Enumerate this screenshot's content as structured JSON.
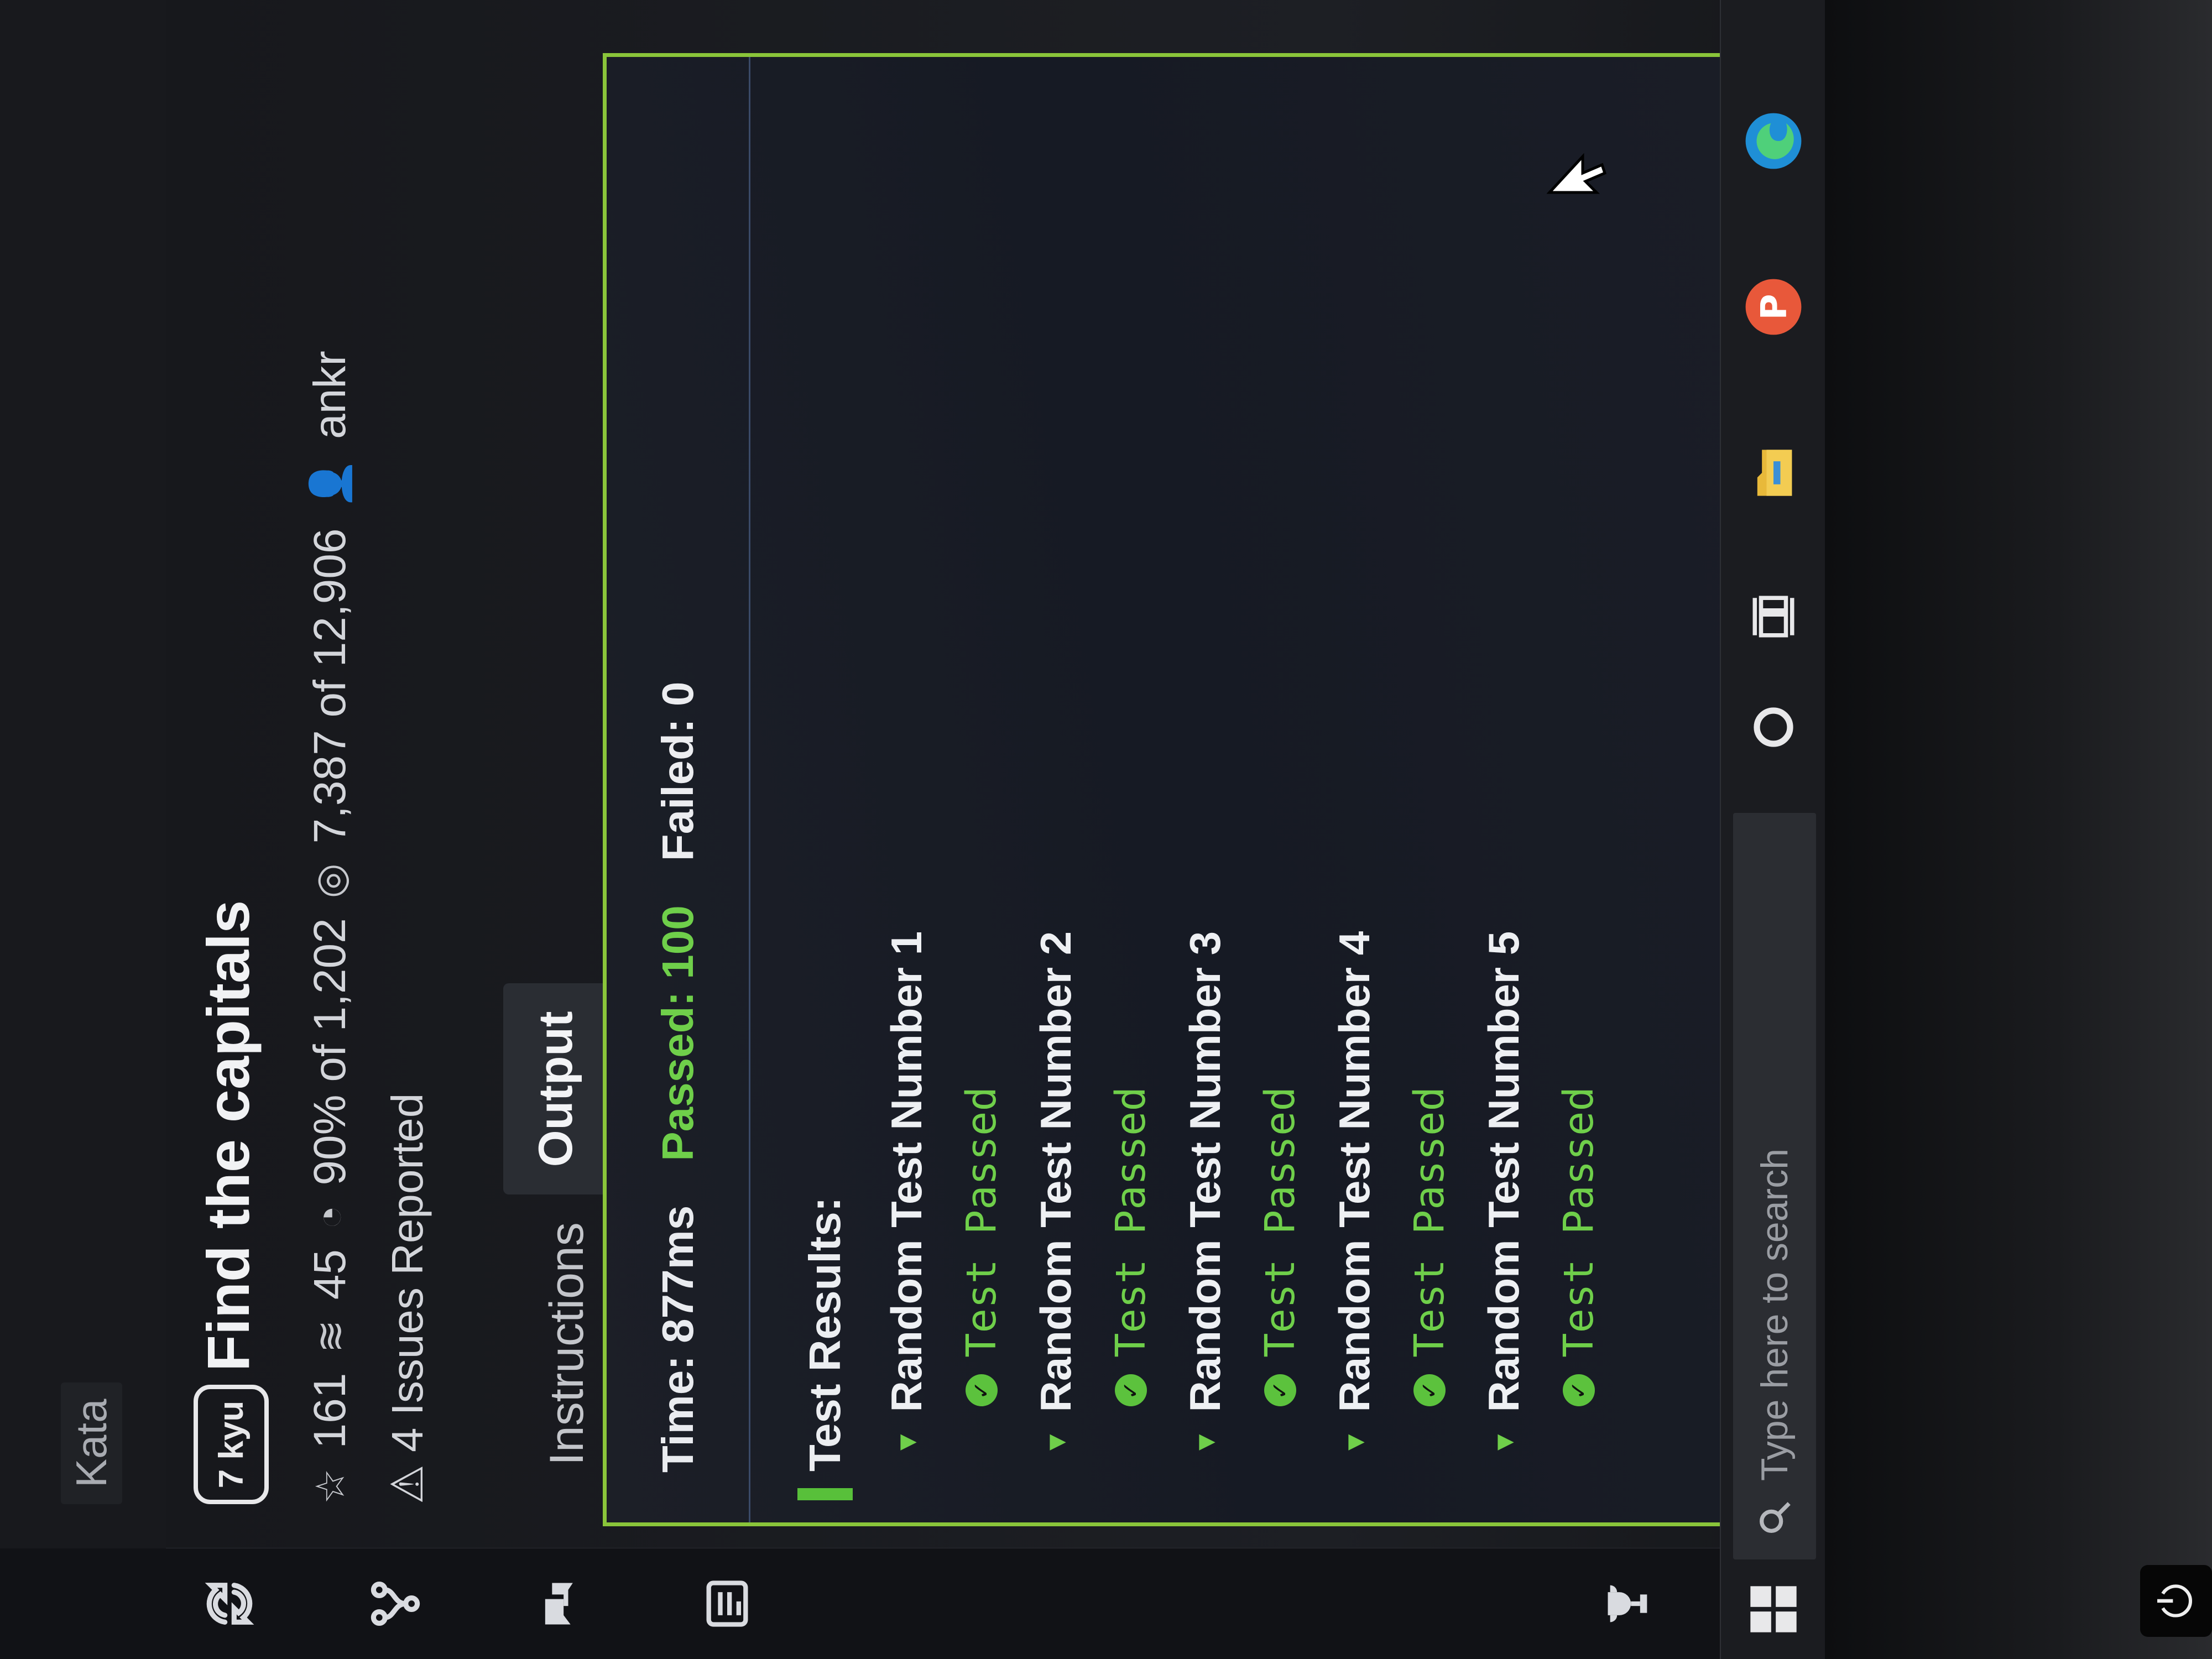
{
  "breadcrumb": "Kata",
  "kata": {
    "rank": "7 kyu",
    "title": "Find the capitals",
    "stars": "161",
    "collections": "45",
    "satisfaction": "90% of 1,202",
    "completions": "7,387 of 12,906",
    "author": "ankr",
    "issues": "4 Issues Reported"
  },
  "tabs": [
    "Instructions",
    "Output"
  ],
  "active_tab": "Output",
  "output": {
    "time": "Time: 877ms",
    "passed": "Passed: 100",
    "failed": "Failed: 0",
    "results_label": "Test Results:",
    "groups": [
      {
        "title": "Random Test Number 1",
        "result": "Test Passed"
      },
      {
        "title": "Random Test Number 2",
        "result": "Test Passed"
      },
      {
        "title": "Random Test Number 3",
        "result": "Test Passed"
      },
      {
        "title": "Random Test Number 4",
        "result": "Test Passed"
      },
      {
        "title": "Random Test Number 5",
        "result": "Test Passed"
      }
    ]
  },
  "taskbar": {
    "search_placeholder": "Type here to search"
  },
  "colors": {
    "accent_green": "#6fcf4a",
    "panel_border": "#8ac53a",
    "background": "#16171b"
  },
  "icons": {
    "sidebar": [
      "refresh-icon",
      "fork-icon",
      "chat-icon",
      "notes-icon",
      "trophy-icon"
    ],
    "taskbar": [
      "windows-icon",
      "search-icon",
      "cortana-icon",
      "task-view-icon",
      "file-explorer-icon",
      "app-p-icon",
      "edge-icon"
    ]
  }
}
